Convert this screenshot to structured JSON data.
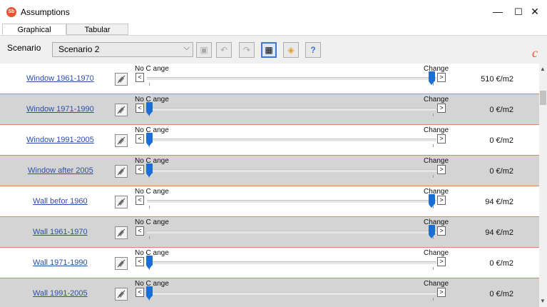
{
  "window": {
    "title": "Assumptions",
    "app_icon": "Sb",
    "minimize": "—",
    "maximize": "☐",
    "close": "✕"
  },
  "tabs": [
    {
      "label": "Graphical",
      "active": true
    },
    {
      "label": "Tabular",
      "active": false
    }
  ],
  "toolbar": {
    "scenario_label": "Scenario",
    "scenario_value": "Scenario 2",
    "dropdown_arrow": "⌵",
    "brand_mark": "c",
    "buttons": [
      {
        "name": "save-icon",
        "glyph": "▣",
        "state": "disabled"
      },
      {
        "name": "undo-icon",
        "glyph": "↶",
        "state": "disabled"
      },
      {
        "name": "redo-icon",
        "glyph": "↷",
        "state": "disabled"
      },
      {
        "name": "calculator-icon",
        "glyph": "▦",
        "state": "active"
      },
      {
        "name": "export-icon",
        "glyph": "◈",
        "state": "normal"
      },
      {
        "name": "help-icon",
        "glyph": "?",
        "state": "normal"
      }
    ]
  },
  "slider_labels": {
    "no_change": "No C ange",
    "change": "Change",
    "left_arrow": "<",
    "right_arrow": ">"
  },
  "rows": [
    {
      "label": "Window 1961-1970",
      "level": 1.0,
      "value": "510 €/m2"
    },
    {
      "label": "Window 1971-1990",
      "level": 0.0,
      "value": "0 €/m2"
    },
    {
      "label": "Window 1991-2005",
      "level": 0.0,
      "value": "0 €/m2"
    },
    {
      "label": "Window after 2005",
      "level": 0.0,
      "value": "0 €/m2"
    },
    {
      "label": "Wall befor 1960",
      "level": 1.0,
      "value": "94 €/m2"
    },
    {
      "label": "Wall 1961-1970",
      "level": 1.0,
      "value": "94 €/m2"
    },
    {
      "label": "Wall 1971-1990",
      "level": 0.0,
      "value": "0 €/m2"
    },
    {
      "label": "Wall 1991-2005",
      "level": 0.0,
      "value": "0 €/m2"
    }
  ],
  "colors": {
    "accent": "#1a6ed4",
    "link": "#2b4fa8",
    "row_alt": "#d4d4d4",
    "row_border": "#d88866",
    "brand": "#e8542e"
  }
}
